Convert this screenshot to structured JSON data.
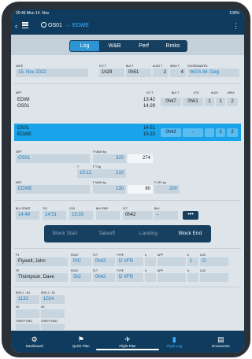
{
  "status": {
    "time_date": "20:46  Mon 14. Nov",
    "battery": "100%"
  },
  "header": {
    "origin": "OS01",
    "destination": "EDWE"
  },
  "tabs": [
    "Log",
    "W&B",
    "Perf",
    "Rmks"
  ],
  "flight": {
    "date_label": "DATE",
    "date": "15. Nov 2022",
    "flt_label": "FLT T",
    "flt_value": "1h29",
    "blk_label": "BLK T",
    "blk_value": "0h51",
    "ldg_label": "#LDG T",
    "ldg_value": "2",
    "pax_label": "#PAX T",
    "pax_value": "4",
    "coord_label": "COORDINATES",
    "coord_value": "WGS 84: Deg"
  },
  "leg_headers": {
    "wpt": "WPT",
    "flt": "FLT T",
    "blk": "BLK T",
    "to": "#TO",
    "ldg": "#LDG",
    "pax": "#PAX"
  },
  "legs": [
    {
      "from": "EDWI",
      "to": "OS01",
      "off": "13:42",
      "on": "14:29",
      "flt": "0h47",
      "blk": "0h51",
      "to_count": "1",
      "ldg": "1",
      "pax": "2"
    },
    {
      "from": "OS01",
      "to": "EDWE",
      "off": "14:51",
      "on": "15:33",
      "flt": "0h42",
      "blk": "-",
      "to_count": "",
      "ldg": "1",
      "pax": "2"
    }
  ],
  "dep": {
    "label": "DEP",
    "value": "OS01",
    "fmain_label": "F MAIN kg",
    "fmain": "320",
    "fmain2": "274",
    "t_label": "T",
    "t_value": "15:12",
    "ft_label": "F T kg",
    "ft": "210"
  },
  "des": {
    "label": "DES",
    "value": "EDWE",
    "fmain_label": "F MAIN kg",
    "fmain": "130",
    "fmain2": "80",
    "fupl_label": "F UPL kg",
    "fupl": "200"
  },
  "times": {
    "blk_start_label": "BLK START",
    "blk_start": "14:49",
    "to_label": "T/O",
    "to": "14:51",
    "ldg_label": "LDG",
    "ldg": "15:33",
    "blk_end_label": "BLK END",
    "blk_end": "",
    "flt_label": "FLT",
    "flt": "0h42",
    "blk_label": "BLK",
    "blk": "-",
    "more": "•••"
  },
  "segments": [
    "Block Start",
    "Takeoff",
    "Landing",
    "Block End"
  ],
  "crew_headers": {
    "p1": "P1",
    "role": "ROLE",
    "flt": "FLT",
    "type": "TYPE",
    "hash": "#",
    "app": "APP",
    "hash2": "#",
    "ldg": "LDG"
  },
  "crew": [
    {
      "label": "P1",
      "name": "Flywell, John",
      "role": "PIC",
      "flt": "0h42",
      "type": "D VFR",
      "count": "",
      "app": "",
      "count2": "1",
      "ldg": "D"
    },
    {
      "label": "P2",
      "name": "Thompson, Dave",
      "role": "SIC",
      "flt": "0h42",
      "type": "D VFR",
      "count": "",
      "app": "",
      "count2": "",
      "ldg": ""
    }
  ],
  "engines": {
    "eng1_label": "ENG 1 - N1",
    "eng1": "1132",
    "eng2_label": "ENG 2 - N1",
    "eng2": "1024",
    "n2_label": "N2",
    "n2b_label": "N2",
    "creep1_label": "CREEP DMG",
    "creep2_label": "CREEP DMG"
  },
  "bottom_tabs": [
    {
      "label": "Dashboard",
      "icon": "gears-icon"
    },
    {
      "label": "Quick Plan",
      "icon": "flag-icon"
    },
    {
      "label": "Flight Plan",
      "icon": "plane-icon"
    },
    {
      "label": "Flight Log",
      "icon": "log-icon"
    },
    {
      "label": "Documents",
      "icon": "book-icon"
    }
  ]
}
